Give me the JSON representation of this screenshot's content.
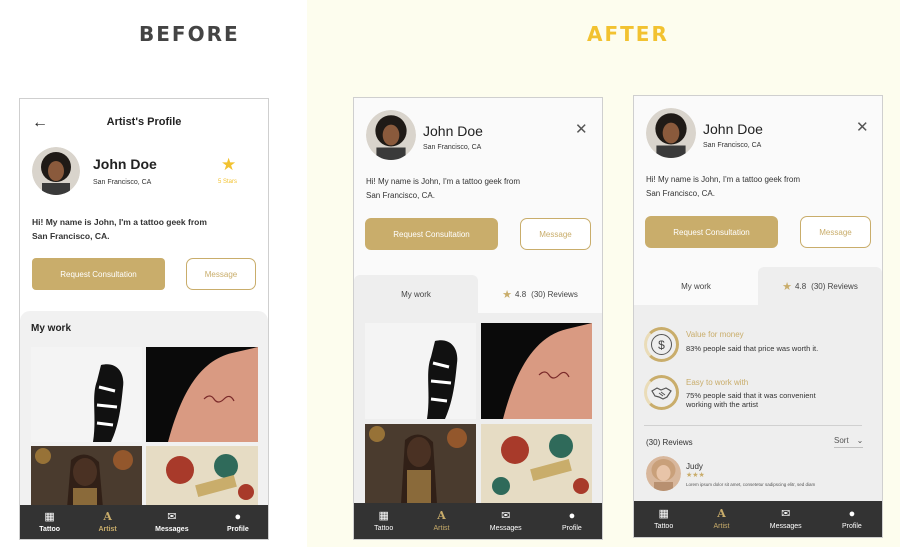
{
  "headings": {
    "before": "BEFORE",
    "after": "AFTER"
  },
  "colors": {
    "accent": "#c9ad6b",
    "after_heading": "#f2c230",
    "before_heading": "#444444",
    "nav_bg": "#333333",
    "star": "#f2c230"
  },
  "profile": {
    "name": "John Doe",
    "location": "San Francisco, CA",
    "bio_line1": "Hi! My name is John, I'm a tattoo geek from",
    "bio_line2": "San Francisco, CA."
  },
  "before": {
    "back_icon": "arrow-left-icon",
    "title": "Artist's Profile",
    "rating_label": "5 Stars",
    "consult_button": "Request Consultation",
    "message_button": "Message",
    "section_title": "My work"
  },
  "after": {
    "consult_button": "Request Consultation",
    "message_button": "Message",
    "tab_work": "My work",
    "rating_value": "4.8",
    "reviews_label": "(30) Reviews",
    "stats": [
      {
        "title": "Value for money",
        "desc": "83% people said that price was worth it.",
        "icon": "dollar-coin-icon"
      },
      {
        "title": "Easy to work with",
        "desc_line1": "75% people said that it was convenient",
        "desc_line2": "working with the artist",
        "icon": "handshake-icon"
      }
    ],
    "reviews_count": "(30) Reviews",
    "sort_label": "Sort",
    "review": {
      "author": "Judy",
      "stars": "★★★",
      "text": "Lorem ipsum dolor sit amet, consetetur sadipscing elitr, sed diam"
    }
  },
  "nav": [
    {
      "label": "Tattoo",
      "icon": "grid-icon",
      "glyph": "▦"
    },
    {
      "label": "Artist",
      "icon": "artist-a-icon",
      "glyph": "A"
    },
    {
      "label": "Messages",
      "icon": "envelope-icon",
      "glyph": "✉"
    },
    {
      "label": "Profile",
      "icon": "user-icon",
      "glyph": "👤"
    }
  ]
}
